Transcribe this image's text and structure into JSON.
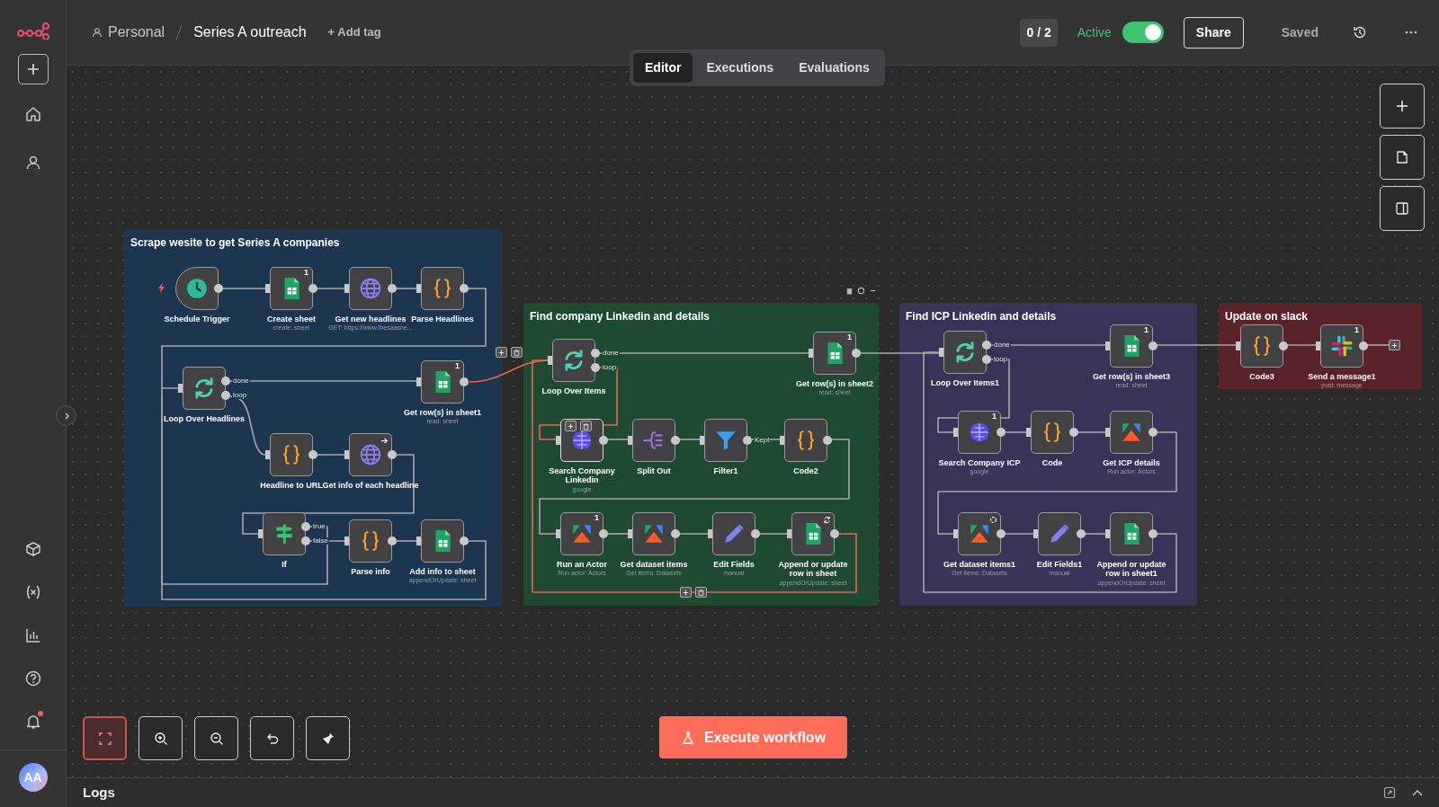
{
  "header": {
    "project": "Personal",
    "workflow_name": "Series A outreach",
    "add_tag": "+ Add tag",
    "eval_counter": "0 / 2",
    "active": {
      "label": "Active",
      "on": true
    },
    "share": "Share",
    "save_status": "Saved"
  },
  "tabs": [
    {
      "label": "Editor",
      "selected": true
    },
    {
      "label": "Executions",
      "selected": false
    },
    {
      "label": "Evaluations",
      "selected": false
    }
  ],
  "sidebar": {
    "avatar": "AA",
    "notifications_unread": true
  },
  "groups": [
    {
      "title": "Scrape wesite to get Series A companies",
      "color": "#1c3650",
      "nodes": [
        {
          "name": "Schedule Trigger",
          "kind": "trigger",
          "hovered": false
        },
        {
          "name": "Create sheet",
          "kind": "sheets",
          "subtitle": "create: sheet",
          "badge": "1",
          "hovered": false
        },
        {
          "name": "Get new headlines",
          "kind": "http",
          "subtitle": "GET: https://www.thesaasne...",
          "hovered": false
        },
        {
          "name": "Parse Headlines",
          "kind": "code",
          "hovered": false
        },
        {
          "name": "Loop Over Headlines",
          "kind": "loop",
          "outputs": [
            "done",
            "loop"
          ],
          "hovered": false
        },
        {
          "name": "Get row(s) in sheet1",
          "kind": "sheets",
          "subtitle": "read: sheet",
          "badge": "1",
          "hovered": false
        },
        {
          "name": "Headline to URL",
          "kind": "code",
          "hovered": false
        },
        {
          "name": "Get info of each headline",
          "kind": "http",
          "status_icon": {
            "kind": "arrow"
          },
          "hovered": false
        },
        {
          "name": "If",
          "kind": "if",
          "outputs": [
            "true",
            "false"
          ],
          "hovered": false
        },
        {
          "name": "Parse info",
          "kind": "code",
          "hovered": false
        },
        {
          "name": "Add info to sheet",
          "kind": "sheets",
          "subtitle": "appendOrUpdate: sheet",
          "hovered": false
        }
      ]
    },
    {
      "title": "Find company Linkedin and details",
      "color": "#1d4a31",
      "nodes": [
        {
          "name": "Loop Over Items",
          "kind": "loop",
          "outputs": [
            "done",
            "loop"
          ],
          "hovered": false
        },
        {
          "name": "Get row(s) in sheet2",
          "kind": "sheets",
          "subtitle": "read: sheet",
          "badge": "1",
          "hovered": false
        },
        {
          "name": "Search Company Linkedin",
          "kind": "serpapi",
          "subtitle": "google",
          "hovered": true
        },
        {
          "name": "Split Out",
          "kind": "split",
          "hovered": false
        },
        {
          "name": "Filter1",
          "kind": "filter",
          "outputs": [
            "Kept"
          ],
          "hovered": false
        },
        {
          "name": "Code2",
          "kind": "code",
          "hovered": false
        },
        {
          "name": "Run an Actor",
          "kind": "apify",
          "subtitle": "Run actor: Actors",
          "badge": "1",
          "hovered": false
        },
        {
          "name": "Get dataset items",
          "kind": "apify",
          "subtitle": "Get items: Datasets",
          "hovered": false
        },
        {
          "name": "Edit Fields",
          "kind": "edit",
          "subtitle": "manual",
          "hovered": false
        },
        {
          "name": "Append or update row in sheet",
          "kind": "sheets",
          "subtitle": "appendOrUpdate: sheet",
          "status_icon": {
            "kind": "refresh"
          },
          "hovered": false
        }
      ]
    },
    {
      "title": "Find ICP Linkedin and details",
      "color": "#393457",
      "nodes": [
        {
          "name": "Loop Over Items1",
          "kind": "loop",
          "outputs": [
            "done",
            "loop"
          ],
          "hovered": false
        },
        {
          "name": "Get row(s) in sheet3",
          "kind": "sheets",
          "subtitle": "read: sheet",
          "badge": "1",
          "hovered": false
        },
        {
          "name": "Search Company ICP",
          "kind": "serpapi",
          "subtitle": "google",
          "badge": "1",
          "hovered": false
        },
        {
          "name": "Code",
          "kind": "code",
          "hovered": false
        },
        {
          "name": "Get ICP details",
          "kind": "apify",
          "subtitle": "Run actor: Actors",
          "hovered": false
        },
        {
          "name": "Get dataset items1",
          "kind": "apify",
          "subtitle": "Get items: Datasets",
          "status_icon": {
            "kind": "spinner"
          },
          "hovered": false
        },
        {
          "name": "Edit Fields1",
          "kind": "edit",
          "subtitle": "manual",
          "hovered": false
        },
        {
          "name": "Append or update row in sheet1",
          "kind": "sheets",
          "subtitle": "appendOrUpdate: sheet",
          "hovered": false
        }
      ]
    },
    {
      "title": "Update on slack",
      "color": "#5a2329",
      "nodes": [
        {
          "name": "Code3",
          "kind": "code",
          "hovered": false
        },
        {
          "name": "Send a message1",
          "kind": "slack",
          "subtitle": "post: message",
          "badge": "1",
          "hovered": false
        }
      ]
    }
  ],
  "canvas_controls": [
    {
      "kind": "fit",
      "highlighted": true
    },
    {
      "kind": "zoom_in",
      "highlighted": false
    },
    {
      "kind": "zoom_out",
      "highlighted": false
    },
    {
      "kind": "undo",
      "highlighted": false
    },
    {
      "kind": "tidy",
      "highlighted": false
    }
  ],
  "execute_button": "Execute workflow",
  "logs": {
    "title": "Logs"
  }
}
